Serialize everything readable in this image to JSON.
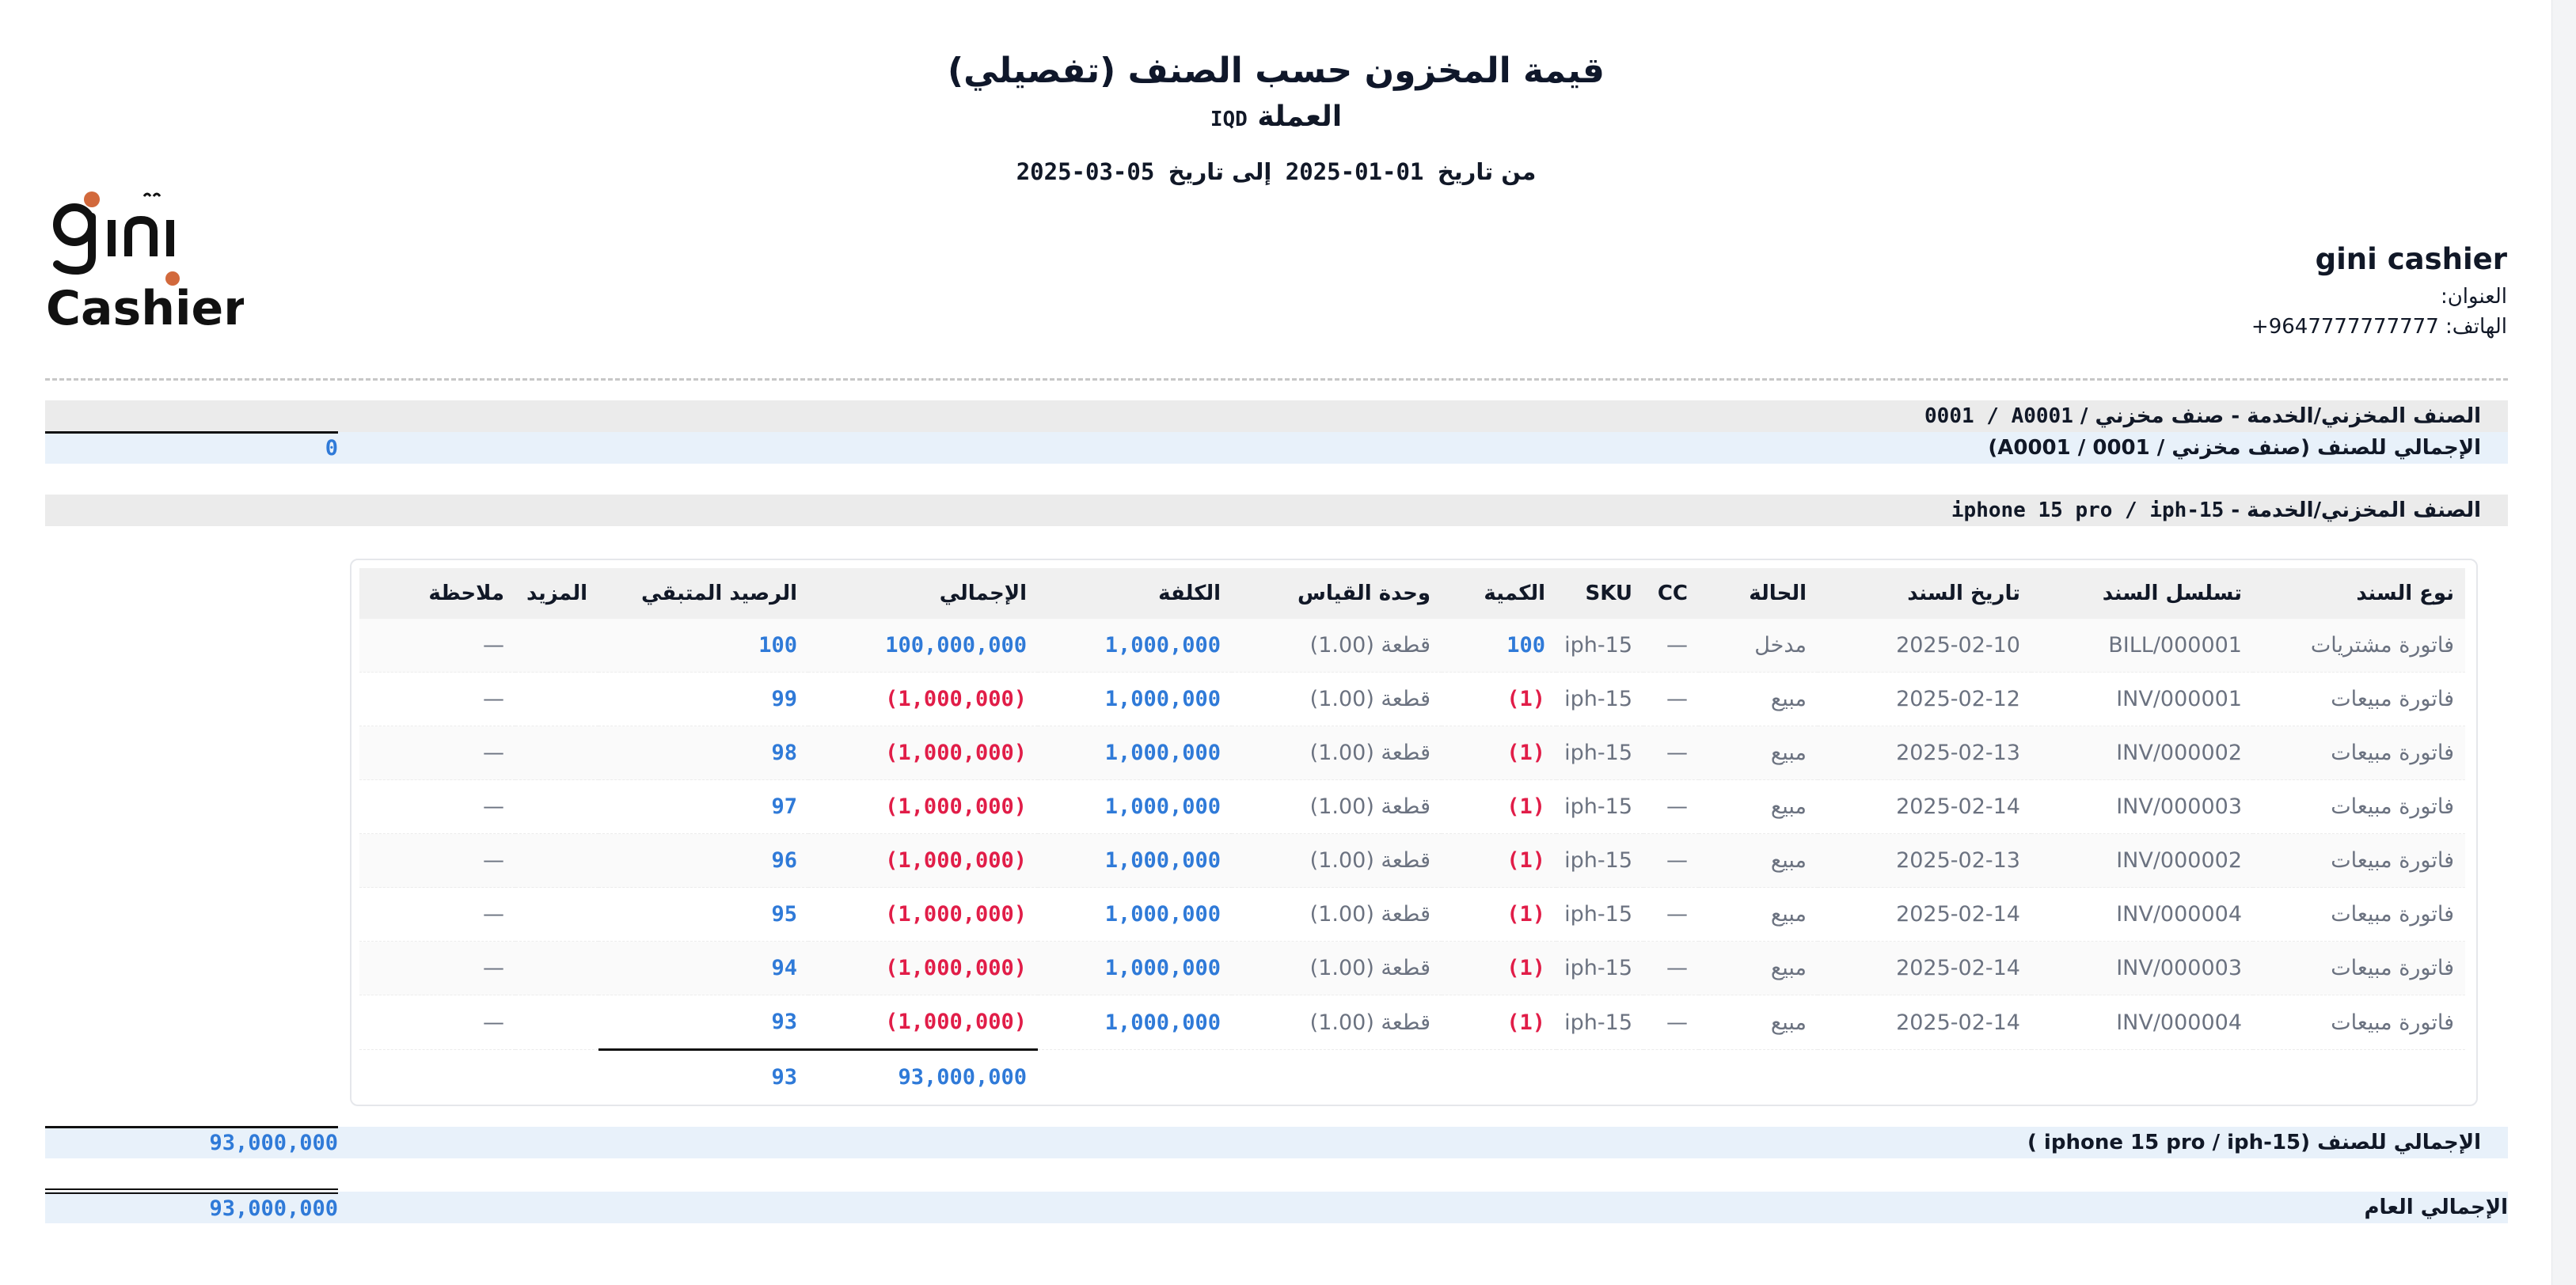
{
  "report": {
    "title": "قيمة المخزون حسب الصنف (تفصيلي)",
    "currency_label": "العملة",
    "currency_code": "IQD",
    "from_label": "من تاريخ",
    "from_date": "2025-01-01",
    "to_label": "إلى تاريخ",
    "to_date": "2025-03-05"
  },
  "logo": {
    "line1": "gini",
    "line2": "Cashier"
  },
  "company": {
    "name": "gini cashier",
    "address_label": "العنوان:",
    "phone_label": "الهاتف:",
    "phone": "+9647777777777"
  },
  "groups": [
    {
      "header_label": "الصنف المخزني/الخدمة - صنف مخزني /",
      "header_code": "0001 / A0001",
      "total_label": "الإجمالي للصنف (صنف مخزني / 0001 / A0001)",
      "total_value": "0"
    },
    {
      "header_label": "الصنف المخزني/الخدمة -",
      "header_code": "iphone 15 pro / iph-15",
      "total_label": "الإجمالي للصنف (iphone 15 pro / iph-15 )",
      "total_value": "93,000,000"
    }
  ],
  "table": {
    "columns": [
      "نوع السند",
      "تسلسل السند",
      "تاريخ السند",
      "الحالة",
      "CC",
      "SKU",
      "الكمية",
      "وحدة القياس",
      "الكلفة",
      "الإجمالي",
      "الرصيد المتبقي",
      "المزيد",
      "ملاحظة"
    ],
    "rows": [
      {
        "type": "فاتورة مشتريات",
        "serial": "BILL/000001",
        "date": "2025-02-10",
        "status": "مدخل",
        "cc": "—",
        "sku": "iph-15",
        "qty": "100",
        "unit": "قطعة (1.00)",
        "cost": "1,000,000",
        "total": "100,000,000",
        "balance": "100",
        "more": "",
        "note": "—"
      },
      {
        "type": "فاتورة مبيعات",
        "serial": "INV/000001",
        "date": "2025-02-12",
        "status": "مبيع",
        "cc": "—",
        "sku": "iph-15",
        "qty": "(1)",
        "unit": "قطعة (1.00)",
        "cost": "1,000,000",
        "total": "(1,000,000)",
        "balance": "99",
        "more": "",
        "note": "—"
      },
      {
        "type": "فاتورة مبيعات",
        "serial": "INV/000002",
        "date": "2025-02-13",
        "status": "مبيع",
        "cc": "—",
        "sku": "iph-15",
        "qty": "(1)",
        "unit": "قطعة (1.00)",
        "cost": "1,000,000",
        "total": "(1,000,000)",
        "balance": "98",
        "more": "",
        "note": "—"
      },
      {
        "type": "فاتورة مبيعات",
        "serial": "INV/000003",
        "date": "2025-02-14",
        "status": "مبيع",
        "cc": "—",
        "sku": "iph-15",
        "qty": "(1)",
        "unit": "قطعة (1.00)",
        "cost": "1,000,000",
        "total": "(1,000,000)",
        "balance": "97",
        "more": "",
        "note": "—"
      },
      {
        "type": "فاتورة مبيعات",
        "serial": "INV/000002",
        "date": "2025-02-13",
        "status": "مبيع",
        "cc": "—",
        "sku": "iph-15",
        "qty": "(1)",
        "unit": "قطعة (1.00)",
        "cost": "1,000,000",
        "total": "(1,000,000)",
        "balance": "96",
        "more": "",
        "note": "—"
      },
      {
        "type": "فاتورة مبيعات",
        "serial": "INV/000004",
        "date": "2025-02-14",
        "status": "مبيع",
        "cc": "—",
        "sku": "iph-15",
        "qty": "(1)",
        "unit": "قطعة (1.00)",
        "cost": "1,000,000",
        "total": "(1,000,000)",
        "balance": "95",
        "more": "",
        "note": "—"
      },
      {
        "type": "فاتورة مبيعات",
        "serial": "INV/000003",
        "date": "2025-02-14",
        "status": "مبيع",
        "cc": "—",
        "sku": "iph-15",
        "qty": "(1)",
        "unit": "قطعة (1.00)",
        "cost": "1,000,000",
        "total": "(1,000,000)",
        "balance": "94",
        "more": "",
        "note": "—"
      },
      {
        "type": "فاتورة مبيعات",
        "serial": "INV/000004",
        "date": "2025-02-14",
        "status": "مبيع",
        "cc": "—",
        "sku": "iph-15",
        "qty": "(1)",
        "unit": "قطعة (1.00)",
        "cost": "1,000,000",
        "total": "(1,000,000)",
        "balance": "93",
        "more": "",
        "note": "—"
      }
    ],
    "footer_total": "93,000,000",
    "footer_balance": "93"
  },
  "grand_total": {
    "label": "الإجمالي العام",
    "value": "93,000,000"
  },
  "colors": {
    "positive": "#2f7ad8",
    "negative": "#e11d48",
    "band_gray": "#ebebeb",
    "band_blue": "#e8f1fa",
    "logo_dot": "#d2693c"
  }
}
